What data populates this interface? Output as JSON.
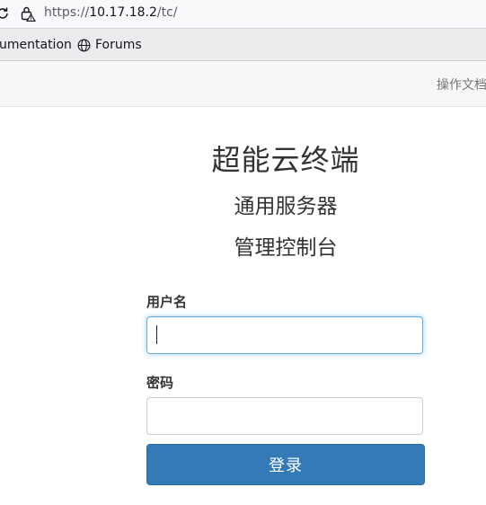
{
  "browser": {
    "url_scheme": "https://",
    "url_host": "10.17.18.2",
    "url_path": "/tc/",
    "reload_icon": "reload-icon",
    "lock_icon": "lock-warning-icon"
  },
  "bookmarks": {
    "items": [
      {
        "label": "umentation"
      },
      {
        "label": "Forums",
        "icon": "globe-icon"
      }
    ]
  },
  "site_header": {
    "docs_link": "操作文档"
  },
  "login": {
    "title": "超能云终端",
    "subtitle_1": "通用服务器",
    "subtitle_2": "管理控制台",
    "username_label": "用户名",
    "username_value": "",
    "password_label": "密码",
    "password_value": "",
    "submit_label": "登录"
  },
  "colors": {
    "primary": "#337ab7",
    "focus_border": "#66afe9",
    "text": "#333333"
  }
}
